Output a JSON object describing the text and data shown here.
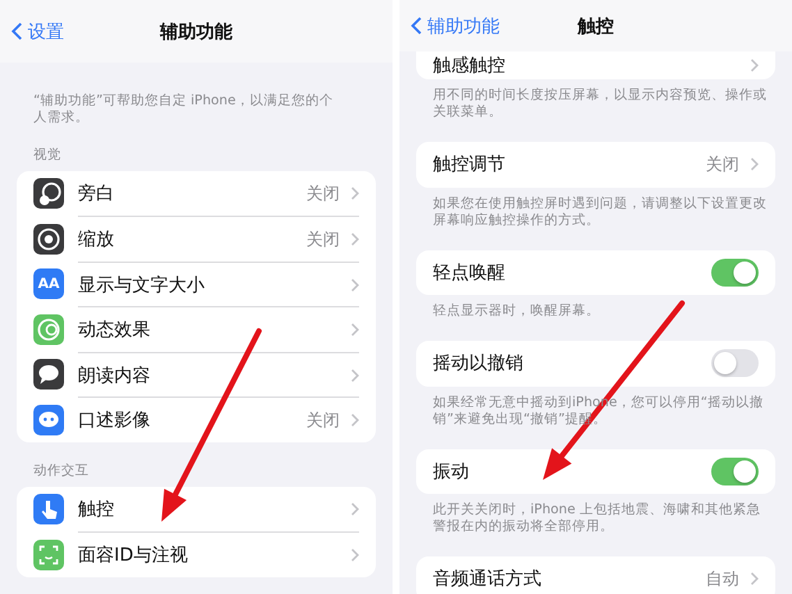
{
  "panels": [
    {
      "back": "设置",
      "title": "辅助功能",
      "sections": [
        {
          "kind": "note",
          "text": "“辅助功能”可帮助您自定 iPhone，以满足您的个人需求。"
        },
        {
          "kind": "header",
          "text": "视觉"
        },
        {
          "kind": "group",
          "rows": [
            {
              "kind": "link",
              "label": "旁白",
              "value": "关闭"
            },
            {
              "kind": "link",
              "label": "缩放",
              "value": "关闭"
            },
            {
              "kind": "link",
              "label": "显示与文字大小",
              "icon_text": "AA"
            },
            {
              "kind": "link",
              "label": "动态效果"
            },
            {
              "kind": "link",
              "label": "朗读内容"
            },
            {
              "kind": "link",
              "label": "口述影像",
              "value": "关闭"
            }
          ]
        },
        {
          "kind": "header",
          "text": "动作交互"
        },
        {
          "kind": "group",
          "rows": [
            {
              "kind": "link",
              "label": "触控"
            },
            {
              "kind": "link",
              "label": "面容ID与注视"
            }
          ]
        }
      ]
    },
    {
      "back": "辅助功能",
      "title": "触控",
      "sections": [
        {
          "kind": "group",
          "rows": [
            {
              "kind": "link",
              "label": "触感触控"
            }
          ]
        },
        {
          "kind": "note",
          "text": "用不同的时间长度按压屏幕，以显示内容预览、操作或关联菜单。"
        },
        {
          "kind": "group",
          "rows": [
            {
              "kind": "link",
              "label": "触控调节",
              "value": "关闭"
            }
          ]
        },
        {
          "kind": "note",
          "text": "如果您在使用触控屏时遇到问题，请调整以下设置更改屏幕响应触控操作的方式。"
        },
        {
          "kind": "group",
          "rows": [
            {
              "kind": "toggle",
              "label": "轻点唤醒",
              "on": true
            }
          ]
        },
        {
          "kind": "note",
          "text": "轻点显示器时，唤醒屏幕。"
        },
        {
          "kind": "group",
          "rows": [
            {
              "kind": "toggle",
              "label": "摇动以撤销",
              "on": false
            }
          ]
        },
        {
          "kind": "note",
          "text": "如果经常无意中摇动到iPhone，您可以停用“摇动以撤销”来避免出现“撤销”提醒。"
        },
        {
          "kind": "group",
          "rows": [
            {
              "kind": "toggle",
              "label": "振动",
              "on": true
            }
          ]
        },
        {
          "kind": "note",
          "text": "此开关关闭时，iPhone 上包括地震、海啸和其他紧急警报在内的振动将全部停用。"
        },
        {
          "kind": "group",
          "rows": [
            {
              "kind": "link",
              "label": "音频通话方式",
              "value": "自动"
            }
          ]
        }
      ]
    }
  ]
}
